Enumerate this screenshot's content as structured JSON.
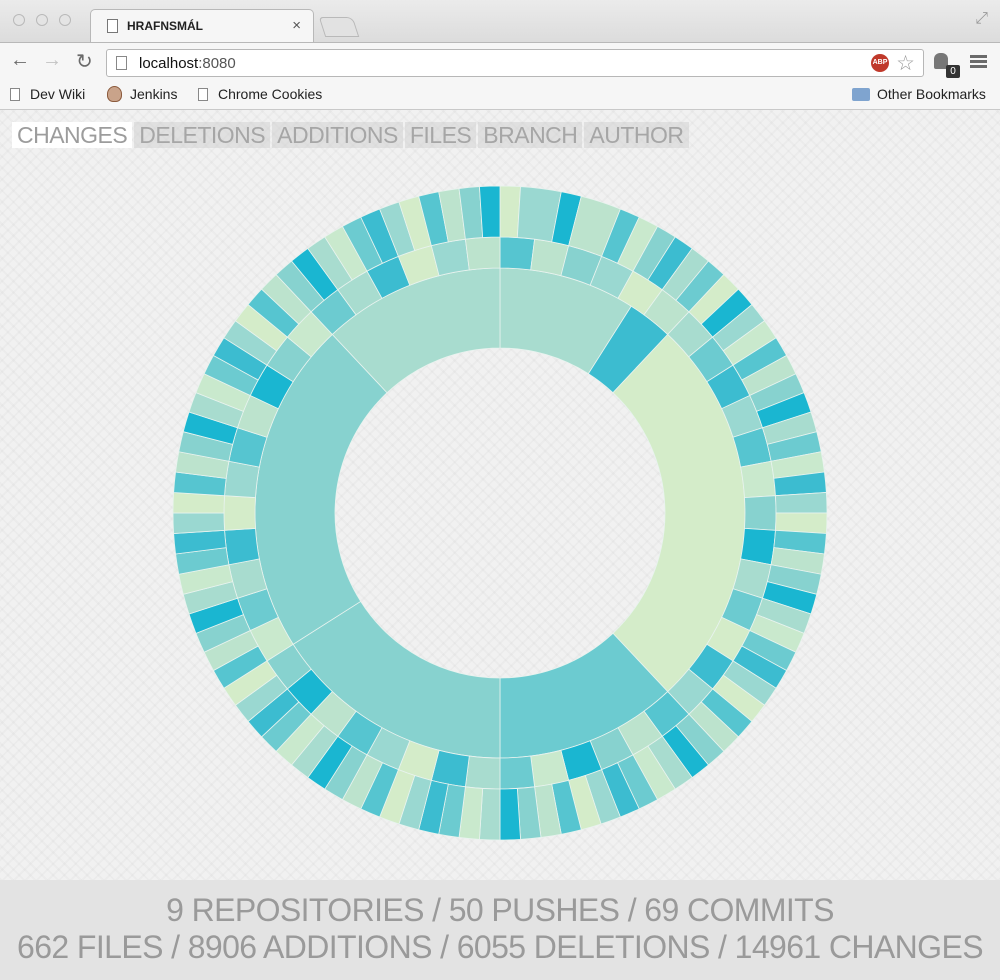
{
  "browser": {
    "tab_title": "HRAFNSMÁL",
    "tab_close": "×",
    "url_host": "localhost",
    "url_port": ":8080",
    "adblock_label": "ABP",
    "extension_badge": "0",
    "bookmarks": [
      "Dev Wiki",
      "Jenkins",
      "Chrome Cookies"
    ],
    "other_bookmarks": "Other Bookmarks"
  },
  "metric_tabs": [
    "CHANGES",
    "DELETIONS",
    "ADDITIONS",
    "FILES",
    "BRANCH",
    "AUTHOR"
  ],
  "active_metric": "CHANGES",
  "summary": {
    "line1": "9 REPOSITORIES / 50 PUSHES / 69 COMMITS",
    "line2": "662 FILES / 8906 ADDITIONS / 6055 DELETIONS / 14961 CHANGES"
  },
  "colors": {
    "palette": [
      "#1ab6d1",
      "#3cbcd0",
      "#56c5d0",
      "#6ccbd0",
      "#87d2cf",
      "#9ad8d1",
      "#a8dccf",
      "#bce3cd",
      "#c9e9cd",
      "#d4ecc9"
    ]
  },
  "chart_data": {
    "type": "sunburst",
    "rings": [
      {
        "name": "inner",
        "segments": [
          [
            0,
            3
          ],
          [
            0,
            6
          ],
          [
            9,
            1
          ],
          [
            12,
            9
          ],
          [
            38,
            3
          ],
          [
            50,
            4
          ],
          [
            66,
            4
          ],
          [
            88,
            6
          ]
        ]
      },
      {
        "name": "middle",
        "segments": [
          [
            0,
            2
          ],
          [
            2,
            7
          ],
          [
            4,
            4
          ],
          [
            6,
            5
          ],
          [
            8,
            9
          ],
          [
            10,
            7
          ],
          [
            12,
            6
          ],
          [
            14,
            3
          ],
          [
            16,
            1
          ],
          [
            18,
            5
          ],
          [
            20,
            2
          ],
          [
            22,
            8
          ],
          [
            24,
            4
          ],
          [
            26,
            0
          ],
          [
            28,
            6
          ],
          [
            30,
            3
          ],
          [
            32,
            9
          ],
          [
            34,
            1
          ],
          [
            36,
            5
          ],
          [
            38,
            2
          ],
          [
            40,
            7
          ],
          [
            42,
            4
          ],
          [
            44,
            0
          ],
          [
            46,
            8
          ],
          [
            48,
            3
          ],
          [
            50,
            6
          ],
          [
            52,
            1
          ],
          [
            54,
            9
          ],
          [
            56,
            5
          ],
          [
            58,
            2
          ],
          [
            60,
            7
          ],
          [
            62,
            0
          ],
          [
            64,
            4
          ],
          [
            66,
            8
          ],
          [
            68,
            3
          ],
          [
            70,
            6
          ],
          [
            72,
            1
          ],
          [
            74,
            9
          ],
          [
            76,
            5
          ],
          [
            78,
            2
          ],
          [
            80,
            7
          ],
          [
            82,
            0
          ],
          [
            84,
            4
          ],
          [
            86,
            8
          ],
          [
            88,
            3
          ],
          [
            90,
            6
          ],
          [
            92,
            1
          ],
          [
            94,
            9
          ],
          [
            96,
            5
          ],
          [
            98,
            7
          ]
        ]
      },
      {
        "name": "outer",
        "segments": [
          [
            0,
            9
          ],
          [
            1,
            5
          ],
          [
            3,
            0
          ],
          [
            4,
            7
          ],
          [
            6,
            2
          ],
          [
            7,
            8
          ],
          [
            8,
            4
          ],
          [
            9,
            1
          ],
          [
            10,
            6
          ],
          [
            11,
            3
          ],
          [
            12,
            9
          ],
          [
            13,
            0
          ],
          [
            14,
            5
          ],
          [
            15,
            8
          ],
          [
            16,
            2
          ],
          [
            17,
            7
          ],
          [
            18,
            4
          ],
          [
            19,
            0
          ],
          [
            20,
            6
          ],
          [
            21,
            3
          ],
          [
            22,
            8
          ],
          [
            23,
            1
          ],
          [
            24,
            5
          ],
          [
            25,
            9
          ],
          [
            26,
            2
          ],
          [
            27,
            7
          ],
          [
            28,
            4
          ],
          [
            29,
            0
          ],
          [
            30,
            6
          ],
          [
            31,
            8
          ],
          [
            32,
            3
          ],
          [
            33,
            1
          ],
          [
            34,
            5
          ],
          [
            35,
            9
          ],
          [
            36,
            2
          ],
          [
            37,
            7
          ],
          [
            38,
            4
          ],
          [
            39,
            0
          ],
          [
            40,
            6
          ],
          [
            41,
            8
          ],
          [
            42,
            3
          ],
          [
            43,
            1
          ],
          [
            44,
            5
          ],
          [
            45,
            9
          ],
          [
            46,
            2
          ],
          [
            47,
            7
          ],
          [
            48,
            4
          ],
          [
            49,
            0
          ],
          [
            50,
            6
          ],
          [
            51,
            8
          ],
          [
            52,
            3
          ],
          [
            53,
            1
          ],
          [
            54,
            5
          ],
          [
            55,
            9
          ],
          [
            56,
            2
          ],
          [
            57,
            7
          ],
          [
            58,
            4
          ],
          [
            59,
            0
          ],
          [
            60,
            6
          ],
          [
            61,
            8
          ],
          [
            62,
            3
          ],
          [
            63,
            1
          ],
          [
            64,
            5
          ],
          [
            65,
            9
          ],
          [
            66,
            2
          ],
          [
            67,
            7
          ],
          [
            68,
            4
          ],
          [
            69,
            0
          ],
          [
            70,
            6
          ],
          [
            71,
            8
          ],
          [
            72,
            3
          ],
          [
            73,
            1
          ],
          [
            74,
            5
          ],
          [
            75,
            9
          ],
          [
            76,
            2
          ],
          [
            77,
            7
          ],
          [
            78,
            4
          ],
          [
            79,
            0
          ],
          [
            80,
            6
          ],
          [
            81,
            8
          ],
          [
            82,
            3
          ],
          [
            83,
            1
          ],
          [
            84,
            5
          ],
          [
            85,
            9
          ],
          [
            86,
            2
          ],
          [
            87,
            7
          ],
          [
            88,
            4
          ],
          [
            89,
            0
          ],
          [
            90,
            6
          ],
          [
            91,
            8
          ],
          [
            92,
            3
          ],
          [
            93,
            1
          ],
          [
            94,
            5
          ],
          [
            95,
            9
          ],
          [
            96,
            2
          ],
          [
            97,
            7
          ],
          [
            98,
            4
          ],
          [
            99,
            0
          ]
        ]
      }
    ]
  }
}
